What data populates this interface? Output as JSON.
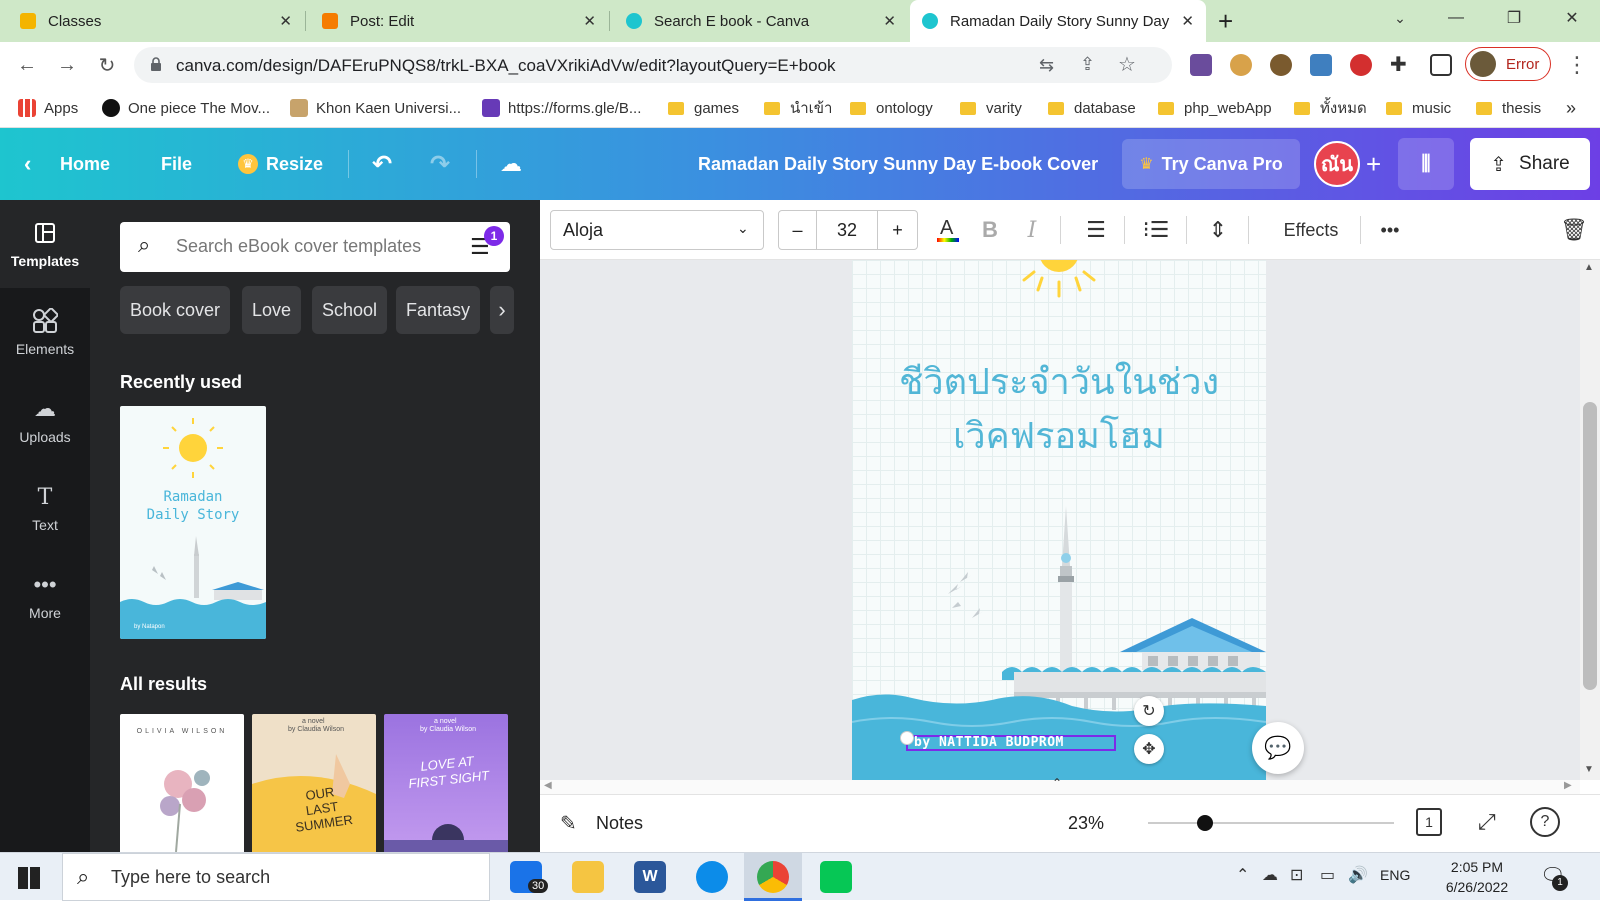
{
  "browser": {
    "tabs": [
      {
        "title": "Classes",
        "favicon_color": "#f4b400"
      },
      {
        "title": "Post: Edit",
        "favicon_color": "#f57c00"
      },
      {
        "title": "Search E book - Canva",
        "favicon_color": "#1ec5cf"
      },
      {
        "title": "Ramadan Daily Story Sunny Day E",
        "favicon_color": "#1ec5cf",
        "active": true
      }
    ],
    "new_tab": "+",
    "url": "canva.com/design/DAFEruPNQS8/trkL-BXA_coaVXrikiAdVw/edit?layoutQuery=E+book",
    "profile_label": "Error",
    "bookmarks": [
      {
        "label": "Apps"
      },
      {
        "label": "One piece The Mov..."
      },
      {
        "label": "Khon Kaen Universi..."
      },
      {
        "label": "https://forms.gle/B..."
      },
      {
        "label": "games"
      },
      {
        "label": "นำเข้า"
      },
      {
        "label": "ontology"
      },
      {
        "label": "varity"
      },
      {
        "label": "database"
      },
      {
        "label": "php_webApp"
      },
      {
        "label": "ทั้งหมด"
      },
      {
        "label": "music"
      },
      {
        "label": "thesis"
      }
    ],
    "more_bookmarks": "»"
  },
  "canva_header": {
    "home": "Home",
    "file": "File",
    "resize": "Resize",
    "design_title": "Ramadan Daily Story Sunny Day E-book Cover",
    "try_pro": "Try Canva Pro",
    "avatar_text": "ณัน",
    "share": "Share"
  },
  "rail": {
    "items": [
      {
        "label": "Templates"
      },
      {
        "label": "Elements"
      },
      {
        "label": "Uploads"
      },
      {
        "label": "Text"
      },
      {
        "label": "More"
      }
    ]
  },
  "panel": {
    "search_placeholder": "Search eBook cover templates",
    "filter_badge": "1",
    "chips": [
      "Book cover",
      "Love",
      "School",
      "Fantasy"
    ],
    "recently_used": "Recently used",
    "all_results": "All results",
    "recent_thumb": {
      "title_line1": "Ramadan",
      "title_line2": "Daily Story",
      "byline": "by Natapon"
    },
    "results": [
      {
        "author": "OLIVIA WILSON",
        "bg": "#ffffff"
      },
      {
        "kicker": "a novel",
        "author": "by Claudia Wilson",
        "title_lines": [
          "OUR",
          "LAST",
          "SUMMER"
        ],
        "bg": "#efe0c8"
      },
      {
        "kicker": "a novel",
        "author": "by Claudia Wilson",
        "title_lines": [
          "LOVE AT",
          "FIRST SIGHT"
        ],
        "bg": "#9b73e0"
      }
    ]
  },
  "toolbar": {
    "font": "Aloja",
    "size": "32",
    "minus": "–",
    "plus": "+",
    "bold": "B",
    "italic": "I",
    "effects": "Effects",
    "more": "•••"
  },
  "canvas": {
    "thai_line1": "ชีวิตประจำวันในช่วง",
    "thai_line2": "เวิคฟรอมโฮม",
    "byline": "by NATTIDA BUDPROM"
  },
  "bottombar": {
    "notes": "Notes",
    "zoom": "23%",
    "zoom_fraction": 0.23,
    "page_count": "1"
  },
  "taskbar": {
    "search_placeholder": "Type here to search",
    "mail_badge": "30",
    "lang": "ENG",
    "time": "2:05 PM",
    "date": "6/26/2022",
    "notif_badge": "1"
  },
  "colors": {
    "canva_gradient_start": "#1ec5cf",
    "canva_gradient_end": "#6d3fe5",
    "selection": "#7d2ae8",
    "sea": "#49b6da",
    "thai_text": "#52b6d6"
  }
}
